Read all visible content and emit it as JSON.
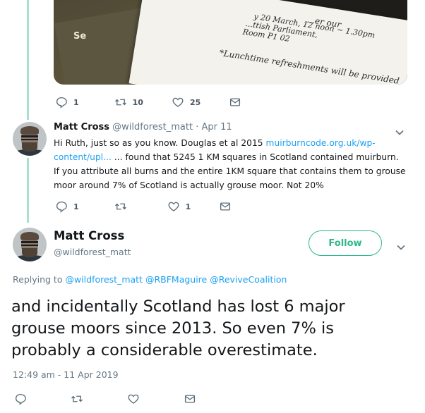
{
  "image_card": {
    "lines": [
      "...er our",
      "y 20 March, 12 noon ~ 1.30pm",
      "...ttish Parliament,",
      "Room P1 02",
      "*Lunchtime refreshments will be provided"
    ],
    "corner_text": "Se"
  },
  "parent_actions": {
    "replies": "1",
    "retweets": "10",
    "likes": "25"
  },
  "reply_tweet": {
    "name": "Matt Cross",
    "handle": "@wildforest_matt",
    "separator": "·",
    "date": "Apr 11",
    "text_line1_a": "Hi Ruth, just so as you know. Douglas et al 2015 ",
    "text_line1_link": "muirburncode.org.uk/wp-",
    "text_line2_link": "content/upl...",
    "text_line2_b": " ... found that 5245 1 KM squares in Scotland contained muirburn.",
    "text_line3": "If you attribute all burns and the entire 1KM square that contains them to grouse",
    "text_line4": "moor around 7% of Scotland is actually grouse moor. Not 20%",
    "actions": {
      "replies": "1",
      "retweets": "",
      "likes": "1"
    }
  },
  "main_tweet": {
    "name": "Matt Cross",
    "handle": "@wildforest_matt",
    "follow_label": "Follow",
    "replying_prefix": "Replying to ",
    "mentions": [
      "@wildforest_matt",
      "@RBFMaguire",
      "@ReviveCoalition"
    ],
    "text_lines": [
      "and incidentally Scotland has lost 6 major",
      "grouse moors since 2013. So even 7% is",
      "probably a considerable overestimate."
    ],
    "timestamp": "12:49 am - 11 Apr 2019"
  },
  "colors": {
    "link": "#1da1f2",
    "follow": "#2bb88a",
    "thread_line": "#a8e2cf",
    "muted": "#657786"
  },
  "icons": [
    "reply-icon",
    "retweet-icon",
    "like-icon",
    "message-icon",
    "chevron-down-icon"
  ]
}
